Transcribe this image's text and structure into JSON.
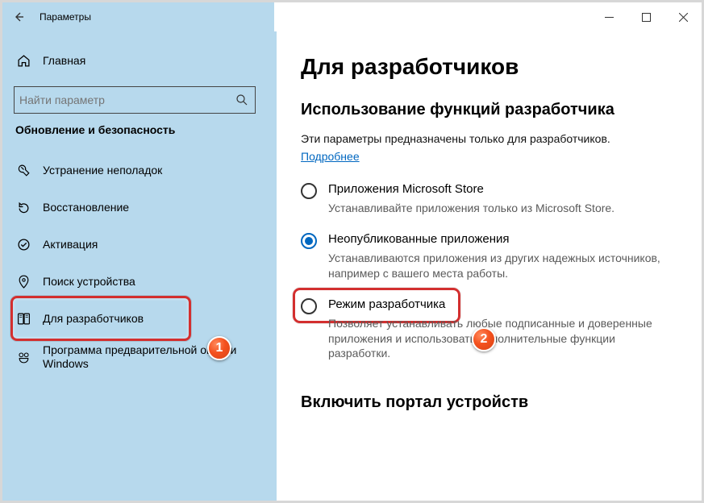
{
  "window": {
    "title": "Параметры"
  },
  "sidebar": {
    "home_label": "Главная",
    "search_placeholder": "Найти параметр",
    "category": "Обновление и безопасность",
    "items": [
      {
        "icon": "wrench",
        "label": "Устранение неполадок"
      },
      {
        "icon": "recovery",
        "label": "Восстановление"
      },
      {
        "icon": "activation",
        "label": "Активация"
      },
      {
        "icon": "finddevice",
        "label": "Поиск устройства"
      },
      {
        "icon": "developers",
        "label": "Для разработчиков"
      },
      {
        "icon": "insider",
        "label": "Программа предварительной оценки Windows"
      }
    ]
  },
  "content": {
    "heading": "Для разработчиков",
    "section1_title": "Использование функций разработчика",
    "section1_desc": "Эти параметры предназначены только для разработчиков.",
    "learn_more": "Подробнее",
    "options": [
      {
        "title": "Приложения Microsoft Store",
        "desc": "Устанавливайте приложения только из Microsoft Store.",
        "checked": false
      },
      {
        "title": "Неопубликованные приложения",
        "desc": "Устанавливаются приложения из других надежных источников, например с вашего места работы.",
        "checked": true
      },
      {
        "title": "Режим разработчика",
        "desc": "Позволяет устанавливать любые подписанные и доверенные приложения и использовать дополнительные функции разработки.",
        "checked": false
      }
    ],
    "section2_title": "Включить портал устройств"
  },
  "callouts": {
    "1": "1",
    "2": "2"
  }
}
